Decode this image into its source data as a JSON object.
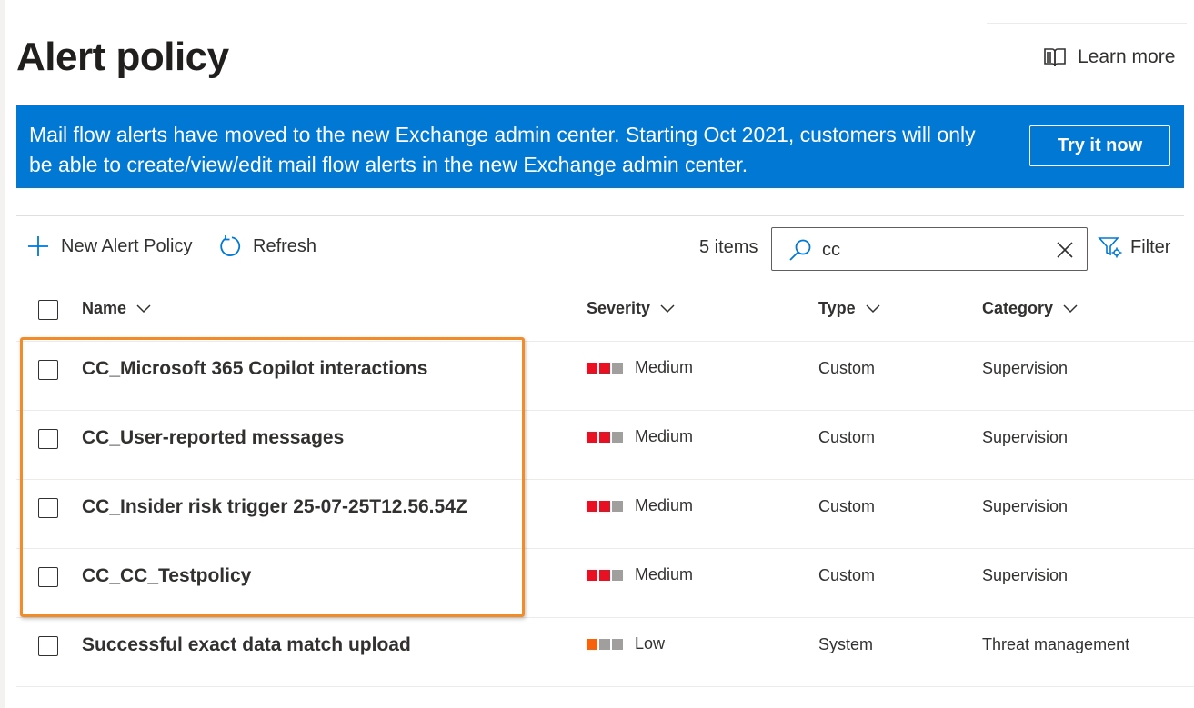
{
  "header": {
    "title": "Alert policy",
    "learn_more": "Learn more"
  },
  "banner": {
    "text": "Mail flow alerts have moved to the new Exchange admin center. Starting Oct 2021, customers will only be able to create/view/edit mail flow alerts in the new Exchange admin center.",
    "button": "Try it now"
  },
  "toolbar": {
    "new_policy": "New Alert Policy",
    "refresh": "Refresh",
    "count": "5 items",
    "search_value": "cc",
    "filter": "Filter"
  },
  "columns": {
    "name": "Name",
    "severity": "Severity",
    "type": "Type",
    "category": "Category"
  },
  "rows": [
    {
      "name": "CC_Microsoft 365 Copilot interactions",
      "severity": "Medium",
      "type": "Custom",
      "category": "Supervision"
    },
    {
      "name": "CC_User-reported messages",
      "severity": "Medium",
      "type": "Custom",
      "category": "Supervision"
    },
    {
      "name": "CC_Insider risk trigger 25-07-25T12.56.54Z",
      "severity": "Medium",
      "type": "Custom",
      "category": "Supervision"
    },
    {
      "name": "CC_CC_Testpolicy",
      "severity": "Medium",
      "type": "Custom",
      "category": "Supervision"
    },
    {
      "name": "Successful exact data match upload",
      "severity": "Low",
      "type": "System",
      "category": "Threat management"
    }
  ],
  "severity_colors": {
    "Medium": [
      "#e81123",
      "#e81123",
      "#a19f9d"
    ],
    "Low": [
      "#f7630c",
      "#a19f9d",
      "#a19f9d"
    ]
  },
  "colors": {
    "banner": "#0078d4",
    "highlight": "#f28c28"
  }
}
